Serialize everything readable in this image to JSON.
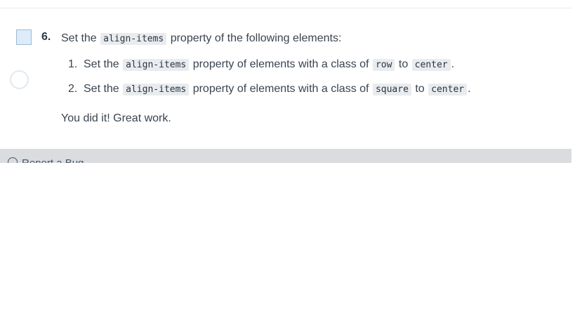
{
  "step": {
    "number": "6.",
    "intro": {
      "before": "Set the",
      "code": "align-items",
      "after": "property of the following elements:"
    },
    "items": [
      {
        "num": "1.",
        "before": "Set the",
        "code1": "align-items",
        "middle": "property of elements with a class of",
        "code2": "row",
        "to": "to",
        "code3": "center",
        "end": "."
      },
      {
        "num": "2.",
        "before": "Set the",
        "code1": "align-items",
        "middle": "property of elements with a class of",
        "code2": "square",
        "to": "to",
        "code3": "center",
        "end": "."
      }
    ],
    "done_text": "You did it! Great work."
  },
  "footer": {
    "report_bug_label": "Report a Bug",
    "icon": "bug-report-icon"
  },
  "colors": {
    "checkbox_fill": "#dcecf8",
    "footer_bg": "#dadcdf",
    "code_bg": "#e9ecef"
  }
}
